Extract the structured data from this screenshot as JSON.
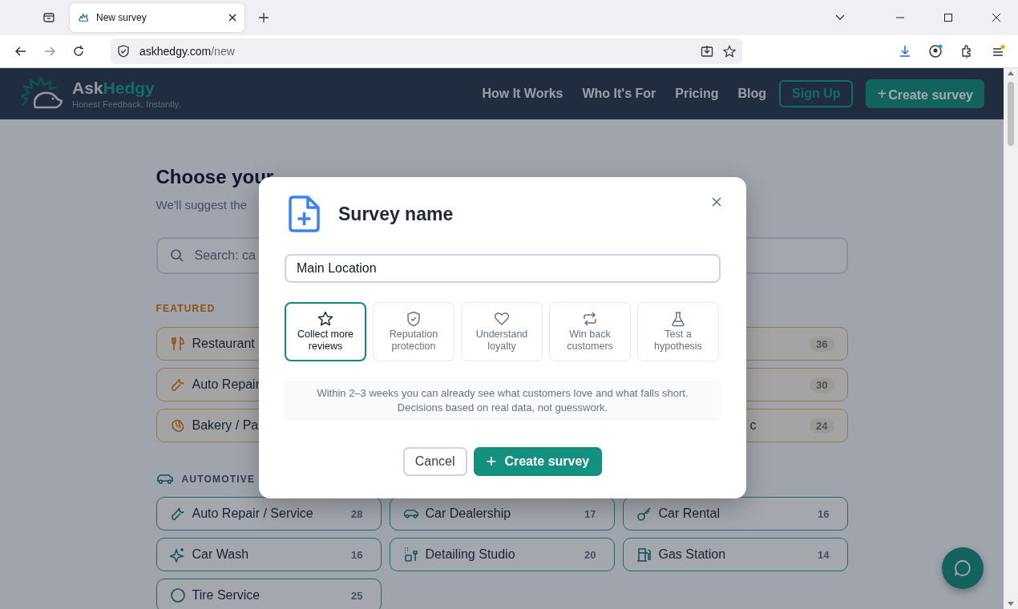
{
  "browser": {
    "tab_title": "New survey",
    "url_host": "askhedgy.com",
    "url_path": "/new"
  },
  "header": {
    "brand_first": "Ask",
    "brand_second": "Hedgy",
    "tagline": "Honest Feedback. Instantly.",
    "nav": [
      "How It Works",
      "Who It's For",
      "Pricing",
      "Blog"
    ],
    "sign_up": "Sign Up",
    "create_plus": "+",
    "create": "Create survey"
  },
  "page": {
    "title": "Choose your",
    "subtitle": "We'll suggest the",
    "search_placeholder": "Search: ca",
    "featured": {
      "label": "FEATURED",
      "cards": [
        {
          "name": "Restaurant"
        },
        {
          "count": "36"
        },
        {
          "name": "Auto Repair"
        },
        {
          "count": "30"
        },
        {
          "name": "Bakery / Pa"
        },
        {
          "name": "c",
          "count": "24"
        }
      ]
    },
    "automotive": {
      "label": "AUTOMOTIVE",
      "cards": [
        {
          "name": "Auto Repair / Service",
          "count": "28"
        },
        {
          "name": "Car Dealership",
          "count": "17"
        },
        {
          "name": "Car Rental",
          "count": "16"
        },
        {
          "name": "Car Wash",
          "count": "16"
        },
        {
          "name": "Detailing Studio",
          "count": "20"
        },
        {
          "name": "Gas Station",
          "count": "14"
        },
        {
          "name": "Tire Service",
          "count": "25"
        }
      ]
    }
  },
  "modal": {
    "title": "Survey name",
    "value": "Main Location",
    "goals": [
      {
        "label": "Collect more reviews",
        "selected": true
      },
      {
        "label": "Reputation protection",
        "selected": false
      },
      {
        "label": "Understand loyalty",
        "selected": false
      },
      {
        "label": "Win back customers",
        "selected": false
      },
      {
        "label": "Test a hypothesis",
        "selected": false
      }
    ],
    "note": "Within 2–3 weeks you can already see what customers love and what falls short. Decisions based on real data, not guesswork.",
    "cancel": "Cancel",
    "create_plus": "+",
    "create": "Create survey"
  }
}
